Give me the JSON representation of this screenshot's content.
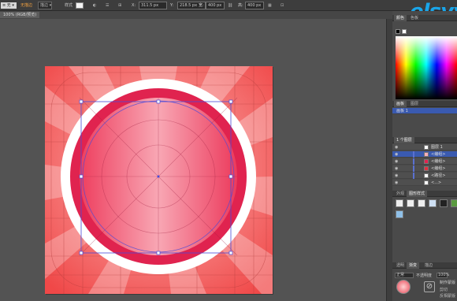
{
  "control_bar": {
    "selection": "≡ 无 ▾",
    "fill_label": "无描边",
    "stroke_dropdown": "描边 ▾",
    "style_label": "样式",
    "fields": [
      "311.5 px",
      "218.5 px",
      "400 px",
      "400 px"
    ],
    "field_labels": [
      "X:",
      "Y:",
      "宽:",
      "高:"
    ]
  },
  "document_tab": "100% (RGB/预览)",
  "watermark": "elsyy",
  "panels": {
    "color_tabs": [
      "颜色",
      "色板"
    ],
    "artboards_tabs": [
      "画板",
      "图层"
    ],
    "artboard_item": "画板 1",
    "layers_tab": "1 个图层",
    "layers": [
      {
        "name": "图层 1",
        "selected": false
      },
      {
        "name": "<编组>",
        "selected": true
      },
      {
        "name": "<编组>",
        "selected": false
      },
      {
        "name": "<编组>",
        "selected": false
      },
      {
        "name": "<路径>",
        "selected": false
      },
      {
        "name": "<...>",
        "selected": false
      }
    ],
    "styles_tabs": [
      "外观",
      "图形样式"
    ],
    "bottom_tabs": [
      "透明",
      "渐变",
      "描边"
    ],
    "blend_mode": "正常",
    "opacity_label": "不透明度",
    "opacity_value": "100%",
    "mask_button": "制作蒙版",
    "clip_label": "剪切",
    "invert_label": "反相蒙版"
  },
  "colors": {
    "artboard_bg": "#f25a5a",
    "ring_red": "#e0234f",
    "ring_white": "#ffffff",
    "inner_center": "#f9a2b0",
    "selection_blue": "#4040d0"
  }
}
